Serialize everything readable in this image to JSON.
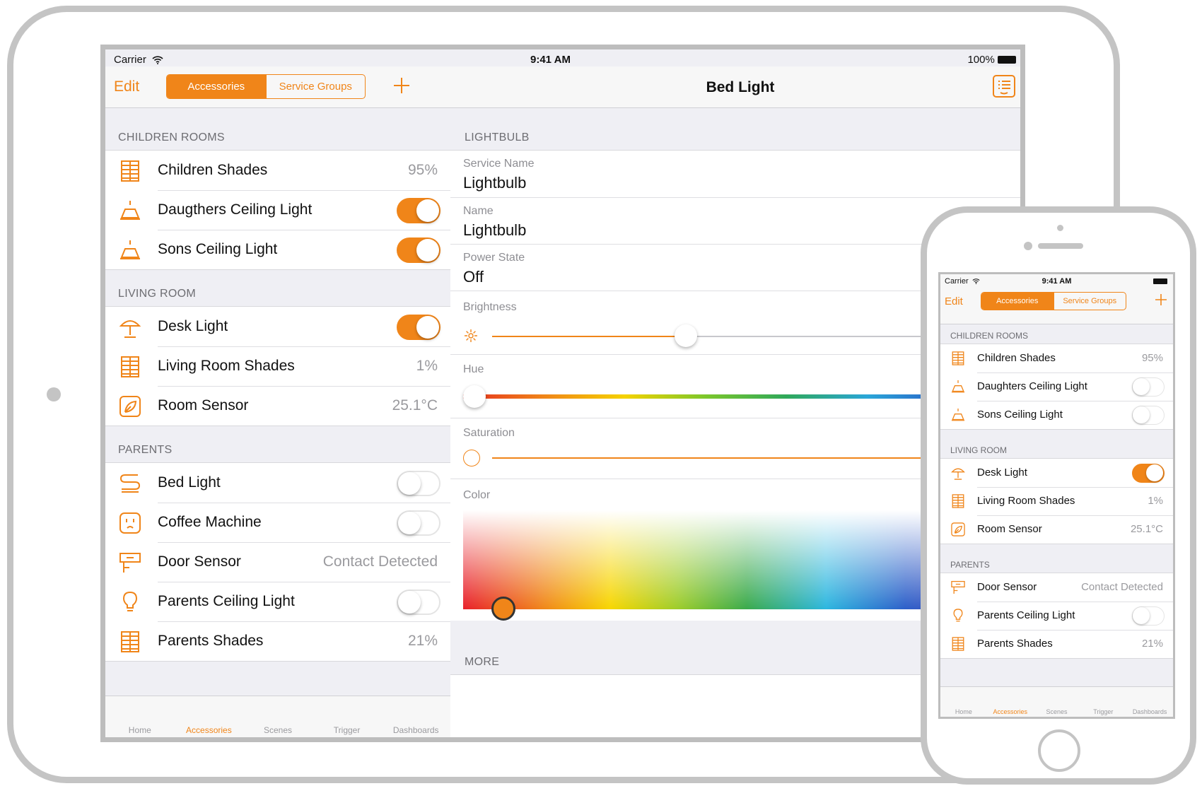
{
  "colors": {
    "accent": "#f08519",
    "bezel": "#c4c4c4"
  },
  "ipad": {
    "status": {
      "carrier": "Carrier",
      "time": "9:41 AM",
      "battery": "100%"
    },
    "master": {
      "edit": "Edit",
      "segments": [
        "Accessories",
        "Service Groups"
      ],
      "add_icon": "plus-icon",
      "sections": [
        {
          "title": "CHILDREN ROOMS",
          "rows": [
            {
              "icon": "shades-icon",
              "label": "Children Shades",
              "value": "95%"
            },
            {
              "icon": "ceiling-light-icon",
              "label": "Daugthers Ceiling Light",
              "toggle": true
            },
            {
              "icon": "ceiling-light-icon",
              "label": "Sons Ceiling Light",
              "toggle": true
            }
          ]
        },
        {
          "title": "LIVING ROOM",
          "rows": [
            {
              "icon": "desk-lamp-icon",
              "label": "Desk Light",
              "toggle": true
            },
            {
              "icon": "shades-icon",
              "label": "Living Room Shades",
              "value": "1%"
            },
            {
              "icon": "sensor-icon",
              "label": "Room Sensor",
              "value": "25.1°C"
            }
          ]
        },
        {
          "title": "PARENTS",
          "rows": [
            {
              "icon": "bed-light-icon",
              "label": "Bed Light",
              "toggle": false
            },
            {
              "icon": "outlet-icon",
              "label": "Coffee Machine",
              "toggle": false
            },
            {
              "icon": "door-sensor-icon",
              "label": "Door Sensor",
              "value": "Contact Detected"
            },
            {
              "icon": "bulb-icon",
              "label": "Parents Ceiling Light",
              "toggle": false
            },
            {
              "icon": "shades-icon",
              "label": "Parents Shades",
              "value": "21%"
            }
          ]
        }
      ],
      "tabs": [
        {
          "icon": "home-icon",
          "label": "Home"
        },
        {
          "icon": "accessories-icon",
          "label": "Accessories",
          "active": true
        },
        {
          "icon": "scenes-icon",
          "label": "Scenes"
        },
        {
          "icon": "trigger-icon",
          "label": "Trigger"
        },
        {
          "icon": "dashboards-icon",
          "label": "Dashboards"
        }
      ]
    },
    "detail": {
      "title": "Bed Light",
      "section": "LIGHTBULB",
      "fields": [
        {
          "label": "Service Name",
          "value": "Lightbulb"
        },
        {
          "label": "Name",
          "value": "Lightbulb"
        },
        {
          "label": "Power State",
          "value": "Off"
        }
      ],
      "brightness_label": "Brightness",
      "brightness_level": 0.36,
      "hue_label": "Hue",
      "hue_level": 0.0,
      "saturation_label": "Saturation",
      "saturation_level": 0.0,
      "color_label": "Color",
      "more": "MORE"
    }
  },
  "iphone": {
    "status": {
      "carrier": "Carrier",
      "time": "9:41 AM"
    },
    "edit": "Edit",
    "segments": [
      "Accessories",
      "Service Groups"
    ],
    "sections": [
      {
        "title": "CHILDREN ROOMS",
        "rows": [
          {
            "icon": "shades-icon",
            "label": "Children Shades",
            "value": "95%"
          },
          {
            "icon": "ceiling-light-icon",
            "label": "Daughters Ceiling Light",
            "toggle": false
          },
          {
            "icon": "ceiling-light-icon",
            "label": "Sons Ceiling Light",
            "toggle": false
          }
        ]
      },
      {
        "title": "LIVING ROOM",
        "rows": [
          {
            "icon": "desk-lamp-icon",
            "label": "Desk Light",
            "toggle": true
          },
          {
            "icon": "shades-icon",
            "label": "Living Room Shades",
            "value": "1%"
          },
          {
            "icon": "sensor-icon",
            "label": "Room Sensor",
            "value": "25.1°C"
          }
        ]
      },
      {
        "title": "PARENTS",
        "rows": [
          {
            "icon": "door-sensor-icon",
            "label": "Door Sensor",
            "value": "Contact Detected"
          },
          {
            "icon": "bulb-icon",
            "label": "Parents Ceiling Light",
            "toggle": false
          },
          {
            "icon": "shades-icon",
            "label": "Parents Shades",
            "value": "21%"
          }
        ]
      }
    ],
    "tabs": [
      {
        "icon": "home-icon",
        "label": "Home"
      },
      {
        "icon": "accessories-icon",
        "label": "Accessories",
        "active": true
      },
      {
        "icon": "scenes-icon",
        "label": "Scenes"
      },
      {
        "icon": "trigger-icon",
        "label": "Trigger"
      },
      {
        "icon": "dashboards-icon",
        "label": "Dashboards"
      }
    ]
  }
}
